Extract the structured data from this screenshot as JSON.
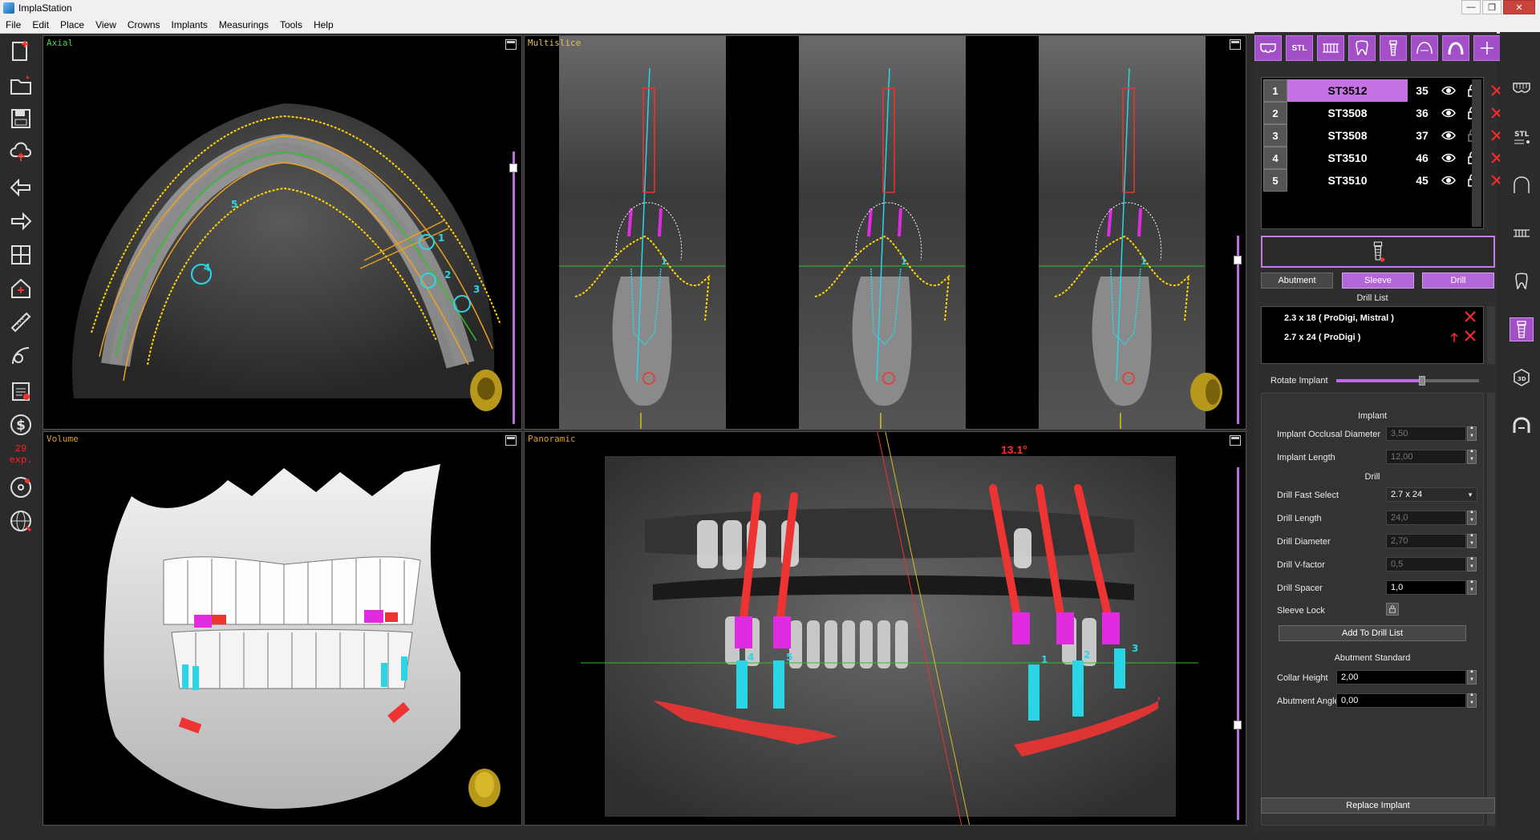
{
  "window": {
    "title": "ImplaStation",
    "minimize": "—",
    "maximize": "❐",
    "close": "✕"
  },
  "menu": [
    "File",
    "Edit",
    "Place",
    "View",
    "Crowns",
    "Implants",
    "Measurings",
    "Tools",
    "Help"
  ],
  "left_toolbar": {
    "counter_value": "29",
    "counter_unit": "exp."
  },
  "viewports": {
    "axial": {
      "label": "Axial",
      "label_color": "#4fd14f"
    },
    "multislice": {
      "label": "Multislice",
      "label_color": "#e0c15a"
    },
    "volume": {
      "label": "Volume",
      "label_color": "#e09a3a"
    },
    "panoramic": {
      "label": "Panoramic",
      "label_color": "#e09a3a",
      "angle": "13.1°"
    }
  },
  "implants": [
    {
      "num": "1",
      "code": "ST3512",
      "tooth": "35",
      "selected": true
    },
    {
      "num": "2",
      "code": "ST3508",
      "tooth": "36",
      "selected": false
    },
    {
      "num": "3",
      "code": "ST3508",
      "tooth": "37",
      "selected": false
    },
    {
      "num": "4",
      "code": "ST3510",
      "tooth": "46",
      "selected": false
    },
    {
      "num": "5",
      "code": "ST3510",
      "tooth": "45",
      "selected": false
    }
  ],
  "tabs": {
    "abutment": "Abutment",
    "sleeve": "Sleeve",
    "drill": "Drill"
  },
  "drill_list": {
    "title": "Drill List",
    "items": [
      "2.3 x 18 ( ProDigi, Mistral )",
      "2.7 x 24 ( ProDigi )"
    ]
  },
  "rotate_implant": {
    "label": "Rotate Implant",
    "value": 0.6
  },
  "implant_section": {
    "title": "Implant",
    "occlusal_diameter_label": "Implant Occlusal Diameter",
    "occlusal_diameter_value": "3,50",
    "length_label": "Implant Length",
    "length_value": "12,00"
  },
  "drill_section": {
    "title": "Drill",
    "fast_select_label": "Drill Fast Select",
    "fast_select_value": "2.7 x 24",
    "length_label": "Drill Length",
    "length_value": "24,0",
    "diameter_label": "Drill Diameter",
    "diameter_value": "2,70",
    "vfactor_label": "Drill V-factor",
    "vfactor_value": "0,5",
    "spacer_label": "Drill Spacer",
    "spacer_value": "1,0",
    "sleeve_lock_label": "Sleeve Lock",
    "add_button": "Add To Drill List"
  },
  "abutment_section": {
    "title": "Abutment Standard",
    "collar_label": "Collar Height",
    "collar_value": "2,00",
    "angle_label": "Abutment Angle",
    "angle_value": "0,00"
  },
  "replace_button": "Replace Implant",
  "top_icons": [
    "crown-icon",
    "stl-icon",
    "teeth-row-icon",
    "tooth-icon",
    "implant-icon",
    "arch-guide-icon",
    "arch-icon",
    "plus-icon",
    "patient-list-icon"
  ],
  "top_icon_labels": {
    "stl": "STL"
  },
  "right_icons": [
    "denture-icon",
    "stl-settings-icon",
    "nerve-icon",
    "teeth-set-icon",
    "tooth-outline-icon",
    "implant-icon",
    "cube-3d-icon",
    "sleeve-guide-icon"
  ]
}
